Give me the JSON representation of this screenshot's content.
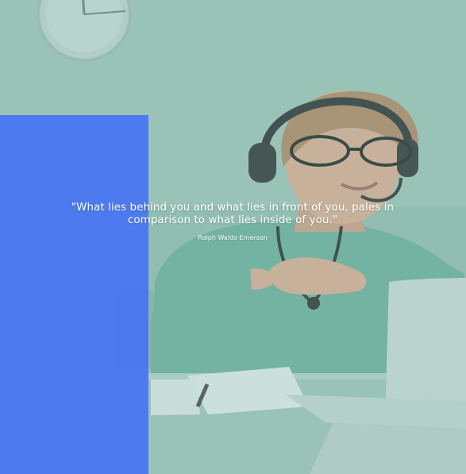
{
  "hero": {
    "quote": "\"What lies behind you and what lies in front of you, pales in comparison to what lies inside of you.\"",
    "author": "Ralph Waldo Emerson"
  },
  "colors": {
    "accent_panel": "#4a78ef",
    "overlay": "#8fb9ad",
    "text": "#ffffff"
  },
  "image": {
    "subject": "doctor-with-headset-at-laptop"
  }
}
